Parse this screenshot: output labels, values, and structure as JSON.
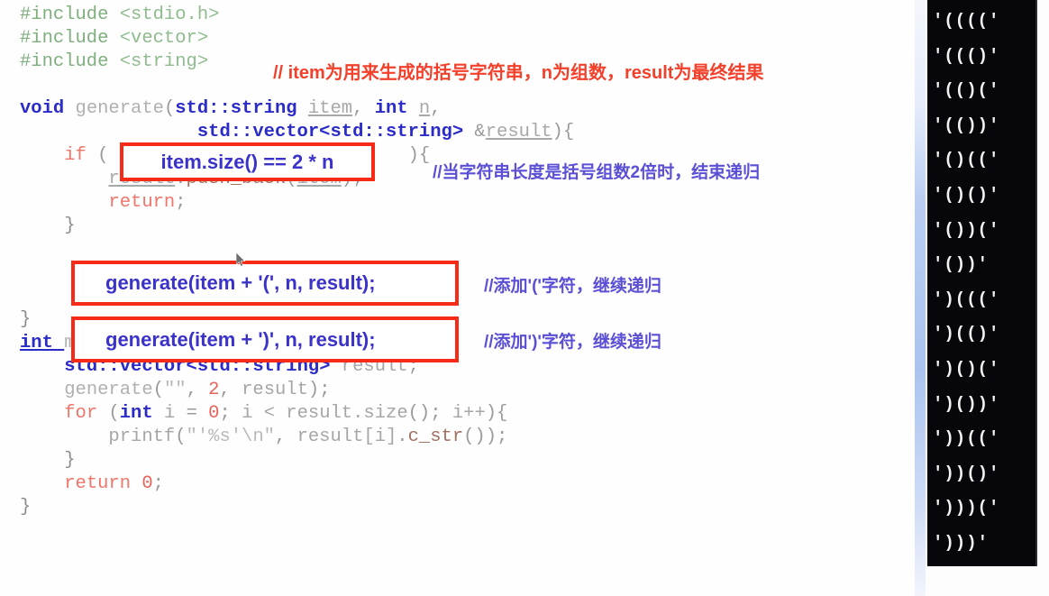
{
  "editor": {
    "language": "C++",
    "code_lines": [
      {
        "indent": 0,
        "tokens": [
          {
            "t": "#include ",
            "c": "t-pre"
          },
          {
            "t": "<stdio.h>",
            "c": "t-hdr"
          }
        ]
      },
      {
        "indent": 0,
        "tokens": [
          {
            "t": "#include ",
            "c": "t-pre"
          },
          {
            "t": "<vector>",
            "c": "t-hdr"
          }
        ]
      },
      {
        "indent": 0,
        "tokens": [
          {
            "t": "#include ",
            "c": "t-pre"
          },
          {
            "t": "<string>",
            "c": "t-hdr"
          }
        ]
      },
      {
        "indent": 0,
        "tokens": []
      },
      {
        "indent": 0,
        "tokens": [
          {
            "t": "void ",
            "c": "t-kw"
          },
          {
            "t": "generate",
            "c": "t-fn"
          },
          {
            "t": "(",
            "c": "t-punc"
          },
          {
            "t": "std::string ",
            "c": "t-type"
          },
          {
            "t": "item",
            "c": "t-var"
          },
          {
            "t": ", ",
            "c": "t-punc"
          },
          {
            "t": "int ",
            "c": "t-kw"
          },
          {
            "t": "n",
            "c": "t-var"
          },
          {
            "t": ",",
            "c": "t-punc"
          }
        ]
      },
      {
        "indent": 0,
        "tokens": [
          {
            "t": "                ",
            "c": "t-plain"
          },
          {
            "t": "std::vector",
            "c": "t-type"
          },
          {
            "t": "<",
            "c": "t-type"
          },
          {
            "t": "std::string",
            "c": "t-type"
          },
          {
            "t": "> ",
            "c": "t-type"
          },
          {
            "t": "&",
            "c": "t-punc"
          },
          {
            "t": "result",
            "c": "t-var"
          },
          {
            "t": "){",
            "c": "t-punc"
          }
        ]
      },
      {
        "indent": 0,
        "tokens": [
          {
            "t": "    ",
            "c": "t-plain"
          },
          {
            "t": "if",
            "c": "t-ret"
          },
          {
            "t": " (",
            "c": "t-punc"
          },
          {
            "t": "                           ",
            "c": "t-plain"
          },
          {
            "t": "){",
            "c": "t-punc"
          }
        ]
      },
      {
        "indent": 0,
        "tokens": [
          {
            "t": "        ",
            "c": "t-plain"
          },
          {
            "t": "result",
            "c": "t-var"
          },
          {
            "t": ".",
            "c": "t-punc"
          },
          {
            "t": "push_back",
            "c": "t-meth"
          },
          {
            "t": "(",
            "c": "t-punc"
          },
          {
            "t": "item",
            "c": "t-var"
          },
          {
            "t": ");",
            "c": "t-punc"
          }
        ]
      },
      {
        "indent": 0,
        "tokens": [
          {
            "t": "        ",
            "c": "t-plain"
          },
          {
            "t": "return",
            "c": "t-ret"
          },
          {
            "t": ";",
            "c": "t-punc"
          }
        ]
      },
      {
        "indent": 0,
        "tokens": [
          {
            "t": "    }",
            "c": "t-brace"
          }
        ]
      },
      {
        "indent": 0,
        "tokens": []
      },
      {
        "indent": 0,
        "tokens": []
      },
      {
        "indent": 0,
        "tokens": []
      },
      {
        "indent": 0,
        "tokens": [
          {
            "t": "}",
            "c": "t-brace"
          }
        ]
      },
      {
        "indent": 0,
        "tokens": [
          {
            "t": "int ",
            "c": "t-kw-u"
          },
          {
            "t": "main",
            "c": "t-fn"
          },
          {
            "t": "(){",
            "c": "t-punc"
          }
        ]
      },
      {
        "indent": 0,
        "tokens": [
          {
            "t": "    ",
            "c": "t-plain"
          },
          {
            "t": "std::vector",
            "c": "t-type"
          },
          {
            "t": "<",
            "c": "t-type"
          },
          {
            "t": "std::string",
            "c": "t-type"
          },
          {
            "t": "> ",
            "c": "t-type"
          },
          {
            "t": "result",
            "c": "t-plain"
          },
          {
            "t": ";",
            "c": "t-punc"
          }
        ]
      },
      {
        "indent": 0,
        "tokens": [
          {
            "t": "    ",
            "c": "t-plain"
          },
          {
            "t": "generate",
            "c": "t-fn"
          },
          {
            "t": "(",
            "c": "t-punc"
          },
          {
            "t": "\"\"",
            "c": "t-str"
          },
          {
            "t": ", ",
            "c": "t-punc"
          },
          {
            "t": "2",
            "c": "t-num"
          },
          {
            "t": ", ",
            "c": "t-punc"
          },
          {
            "t": "result",
            "c": "t-plain"
          },
          {
            "t": ");",
            "c": "t-punc"
          }
        ]
      },
      {
        "indent": 0,
        "tokens": [
          {
            "t": "    ",
            "c": "t-plain"
          },
          {
            "t": "for",
            "c": "t-ret"
          },
          {
            "t": " (",
            "c": "t-punc"
          },
          {
            "t": "int ",
            "c": "t-kw"
          },
          {
            "t": "i ",
            "c": "t-plain"
          },
          {
            "t": "= ",
            "c": "t-punc"
          },
          {
            "t": "0",
            "c": "t-num"
          },
          {
            "t": "; ",
            "c": "t-punc"
          },
          {
            "t": "i < result.size",
            "c": "t-plain"
          },
          {
            "t": "(); ",
            "c": "t-punc"
          },
          {
            "t": "i++",
            "c": "t-plain"
          },
          {
            "t": "){",
            "c": "t-punc"
          }
        ]
      },
      {
        "indent": 0,
        "tokens": [
          {
            "t": "        ",
            "c": "t-plain"
          },
          {
            "t": "printf",
            "c": "t-plain"
          },
          {
            "t": "(",
            "c": "t-punc"
          },
          {
            "t": "\"'%s'\\n\"",
            "c": "t-str"
          },
          {
            "t": ", ",
            "c": "t-punc"
          },
          {
            "t": "result[i]",
            "c": "t-plain"
          },
          {
            "t": ".",
            "c": "t-punc"
          },
          {
            "t": "c_str",
            "c": "t-meth"
          },
          {
            "t": "());",
            "c": "t-punc"
          }
        ]
      },
      {
        "indent": 0,
        "tokens": [
          {
            "t": "    }",
            "c": "t-brace"
          }
        ]
      },
      {
        "indent": 0,
        "tokens": [
          {
            "t": "    ",
            "c": "t-plain"
          },
          {
            "t": "return ",
            "c": "t-ret"
          },
          {
            "t": "0",
            "c": "t-num"
          },
          {
            "t": ";",
            "c": "t-punc"
          }
        ]
      },
      {
        "indent": 0,
        "tokens": [
          {
            "t": "}",
            "c": "t-brace"
          }
        ]
      }
    ]
  },
  "highlight_boxes": {
    "condition": "item.size() == 2 * n",
    "recurse_open": "generate(item + '(', n, result);",
    "recurse_close": "generate(item + ')', n, result);"
  },
  "annotations": {
    "header_comment": "// item为用来生成的括号字符串，n为组数，result为最终结果",
    "condition_comment": "//当字符串长度是括号组数2倍时，结束递归",
    "open_comment": "//添加'('字符，继续递归",
    "close_comment": "//添加')'字符，继续递归"
  },
  "console": {
    "lines": [
      "'(((('",
      "'((()'",
      "'(()('",
      "'(())'",
      "'()(('",
      "'()()'",
      "'())('",
      "'())'",
      "')((('",
      "')(()'",
      "')()('",
      "')())'",
      "'))(('",
      "'))()'",
      "')))('",
      "')))'"
    ]
  },
  "colors": {
    "highlight_border": "#f52b17",
    "highlight_text": "#3b32c9",
    "annotation_red": "#f2402b",
    "annotation_blue": "#5b4fd6",
    "console_bg": "#06060b",
    "console_text": "#f2f2f2",
    "keyword": "#2b2bc8",
    "include": "#7fae7f"
  }
}
